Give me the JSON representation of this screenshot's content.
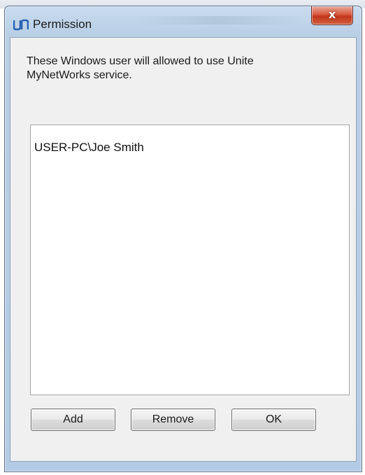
{
  "window": {
    "title": "Permission",
    "close_label": "x"
  },
  "description": "These Windows user will allowed to use Unite MyNetWorks service.",
  "users": [
    "USER-PC\\Joe Smith"
  ],
  "buttons": {
    "add": "Add",
    "remove": "Remove",
    "ok": "OK"
  },
  "colors": {
    "titlebar": "#b9cfe6",
    "close_button": "#c2361b",
    "client_background": "#f0f0f0",
    "default_button": "#bee6fd",
    "app_icon": "#2a63b0"
  },
  "icons": {
    "app": "unite-logo-icon",
    "close": "close-icon"
  }
}
